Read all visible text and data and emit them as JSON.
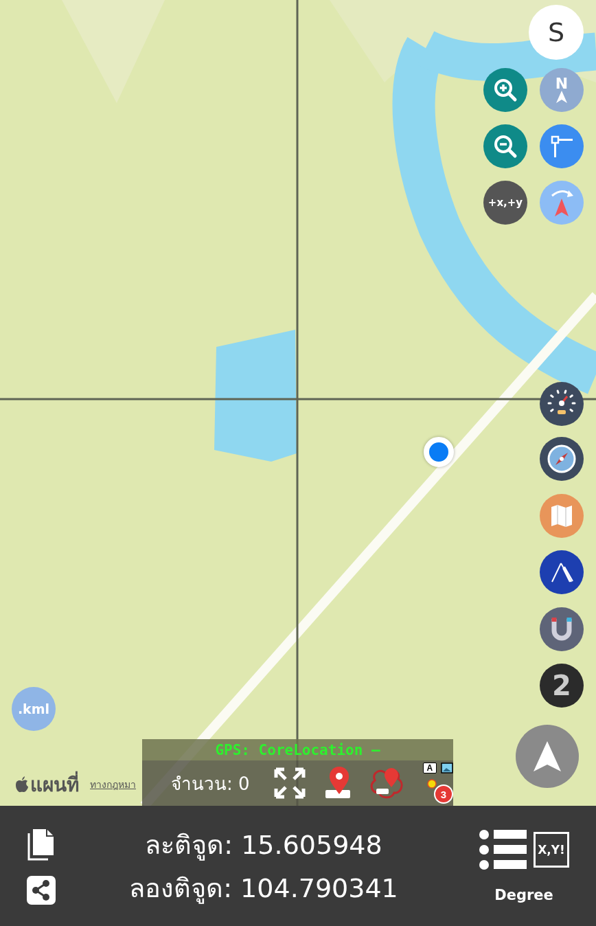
{
  "compass": {
    "heading": "S"
  },
  "map_controls": {
    "north_label": "N",
    "offset_label": "+x,+y",
    "layer_count": "2",
    "kml_label": ".kml"
  },
  "attribution": {
    "logo_text": "แผนที่",
    "legal_link": "ทางกฎหมา"
  },
  "gps_panel": {
    "status": "GPS: CoreLocation –",
    "count_label": "จำนวน: 0",
    "layer_letter": "A",
    "badge_count": "3"
  },
  "bottom_bar": {
    "latitude": "ละติจูด: 15.605948",
    "longitude": "ลองติจูด: 104.790341",
    "xy_label": "X,Y!",
    "unit": "Degree"
  }
}
